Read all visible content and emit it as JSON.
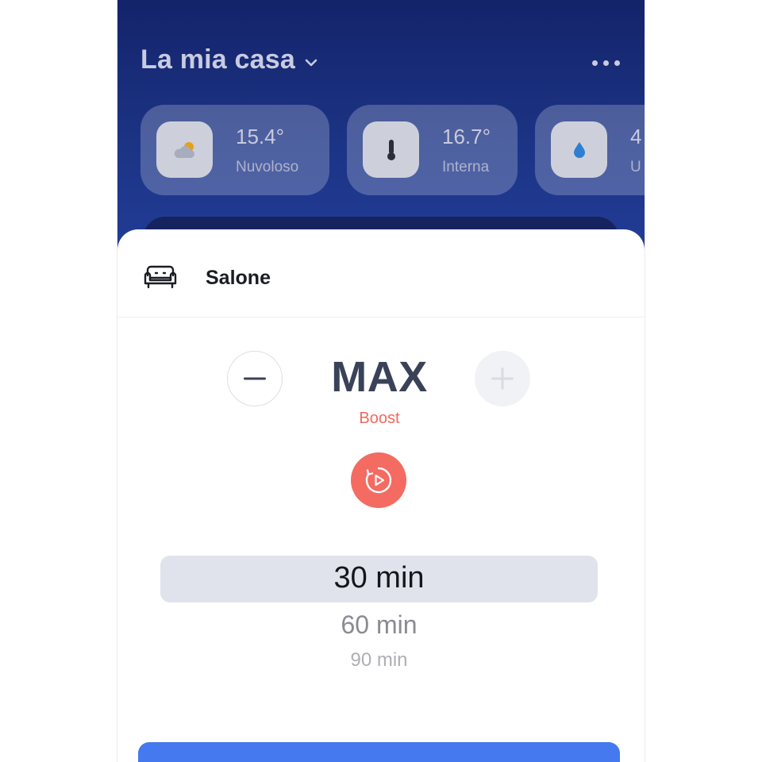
{
  "header": {
    "home_title": "La mia casa"
  },
  "weather_cards": [
    {
      "icon": "cloud-sun-icon",
      "value": "15.4°",
      "label": "Nuvoloso"
    },
    {
      "icon": "thermometer-icon",
      "value": "16.7°",
      "label": "Interna"
    },
    {
      "icon": "water-drop-icon",
      "value": "4",
      "label": "U"
    }
  ],
  "room": {
    "name": "Salone",
    "icon": "sofa-icon"
  },
  "level": {
    "value": "MAX",
    "mode": "Boost"
  },
  "duration_picker": {
    "options": [
      "30 min",
      "60 min",
      "90 min"
    ],
    "selected": "30 min"
  },
  "colors": {
    "header_bg": "#1c3485",
    "boost_accent": "#f36b61",
    "primary_button": "#4479ef",
    "picker_highlight": "#e1e3ec"
  }
}
